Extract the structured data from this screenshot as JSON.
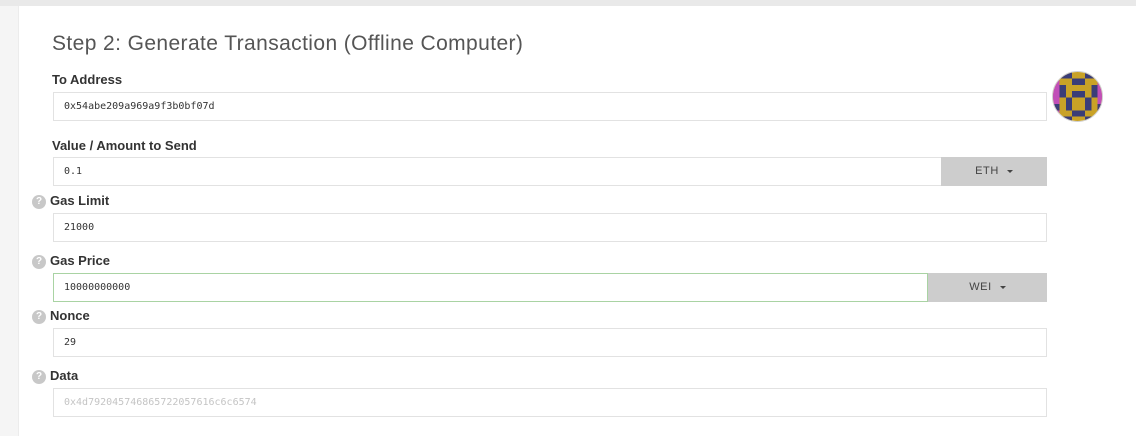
{
  "step_title": "Step 2: Generate Transaction (Offline Computer)",
  "fields": {
    "to_address": {
      "label": "To Address",
      "value": "0x54abe209a969a9f3b0bf07d"
    },
    "value": {
      "label": "Value / Amount to Send",
      "value": "0.1",
      "unit": "ETH"
    },
    "gas_limit": {
      "label": "Gas Limit",
      "value": "21000"
    },
    "gas_price": {
      "label": "Gas Price",
      "value": "10000000000",
      "unit": "WEI"
    },
    "nonce": {
      "label": "Nonce",
      "value": "29"
    },
    "data": {
      "label": "Data",
      "placeholder": "0x4d792045746865722057616c6c6574"
    }
  },
  "help_symbol": "?",
  "icons": {
    "help": "question-circle-icon",
    "dropdown": "caret-down-icon",
    "address_identicon": "identicon-avatar"
  },
  "colors": {
    "identicon_gold": "#c9a227",
    "identicon_navy": "#3a3d78",
    "identicon_magenta": "#c14fb8",
    "focus_border": "#a9d3a3",
    "dropdown_bg": "#cdcdcd"
  }
}
